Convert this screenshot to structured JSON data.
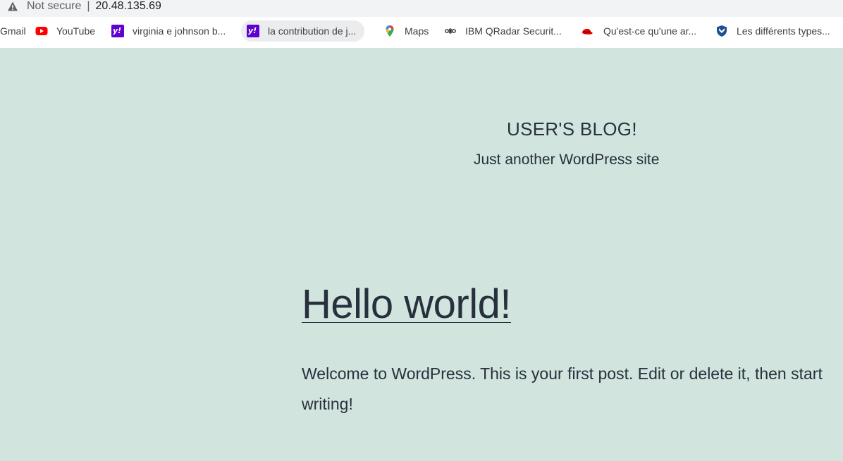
{
  "address_bar": {
    "security_label": "Not secure",
    "separator": "|",
    "url": "20.48.135.69"
  },
  "bookmarks": [
    {
      "label": "Gmail",
      "icon": "gmail-icon"
    },
    {
      "label": "YouTube",
      "icon": "youtube-icon"
    },
    {
      "label": "virginia e johnson b...",
      "icon": "yahoo-icon"
    },
    {
      "label": "la contribution de j...",
      "icon": "yahoo-icon"
    },
    {
      "label": "Maps",
      "icon": "maps-pin-icon"
    },
    {
      "label": "IBM QRadar Securit...",
      "icon": "qradar-icon"
    },
    {
      "label": "Qu'est-ce qu'une ar...",
      "icon": "redhat-icon"
    },
    {
      "label": "Les différents types...",
      "icon": "shield-icon"
    }
  ],
  "site": {
    "title": "USER'S BLOG!",
    "description": "Just another WordPress site"
  },
  "post": {
    "title": "Hello world!",
    "body": "Welcome to WordPress. This is your first post. Edit or delete it, then start writing!"
  },
  "colors": {
    "background": "#d1e4dd",
    "text": "#28303d",
    "yahoo": "#6001d2",
    "youtube": "#ff0000",
    "redhat": "#ee0000"
  }
}
